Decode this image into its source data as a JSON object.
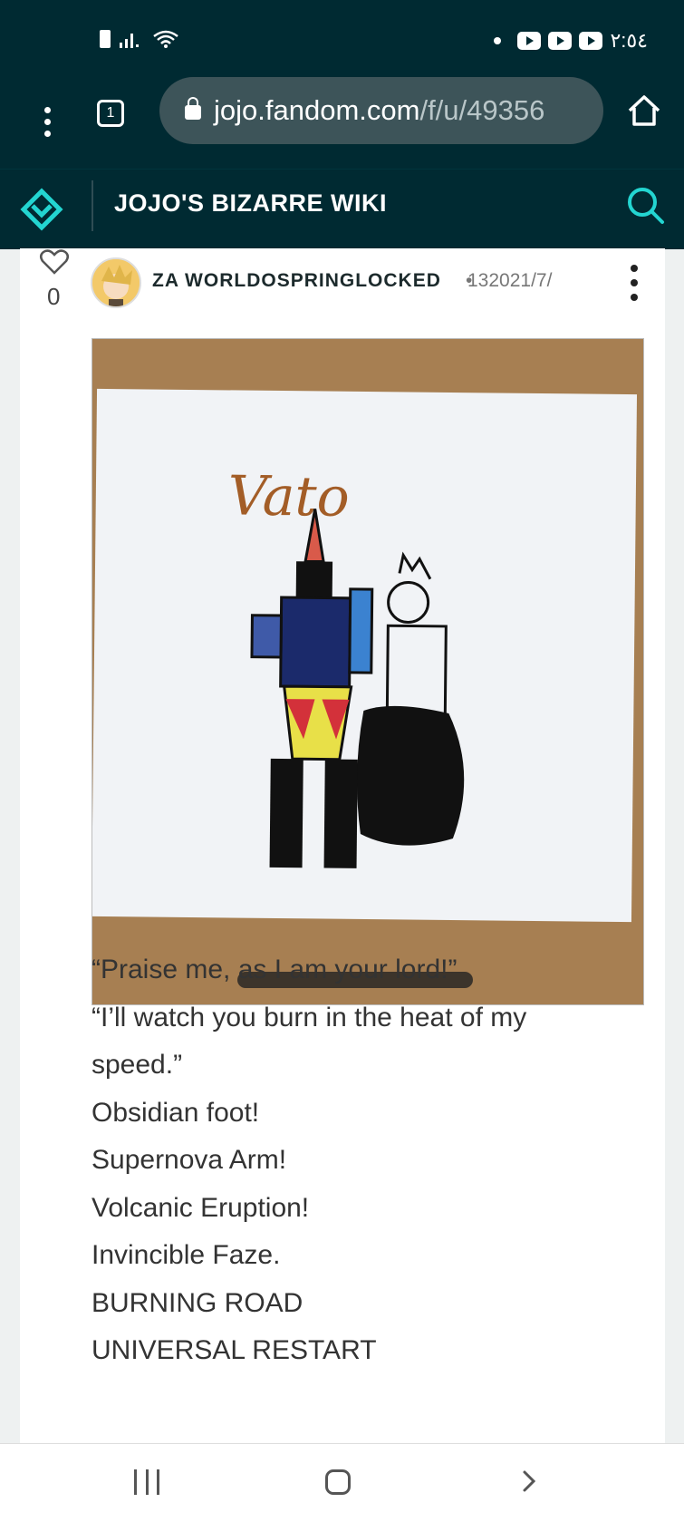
{
  "status": {
    "time": "٢:٥٤"
  },
  "browser": {
    "url": "jojo.fandom.com",
    "url_path": "/f/u/49356",
    "tab_count": "1"
  },
  "wiki": {
    "title": "JOJO'S BIZARRE WIKI"
  },
  "post": {
    "like_count": "0",
    "author": "ZA WORLDOSPRINGLOCKED",
    "separator": "•",
    "date": "132021/7/",
    "image_text": "Vato",
    "lines": [
      "“Praise me, as I am your lord!”",
      "“I’ll watch you burn in the heat of my",
      "speed.”",
      "Obsidian foot!",
      "Supernova Arm!",
      "Volcanic Eruption!",
      "Invincible Faze.",
      "BURNING ROAD",
      "UNIVERSAL RESTART"
    ]
  },
  "colors": {
    "top_bar": "#002a32",
    "accent": "#23d5d1"
  }
}
